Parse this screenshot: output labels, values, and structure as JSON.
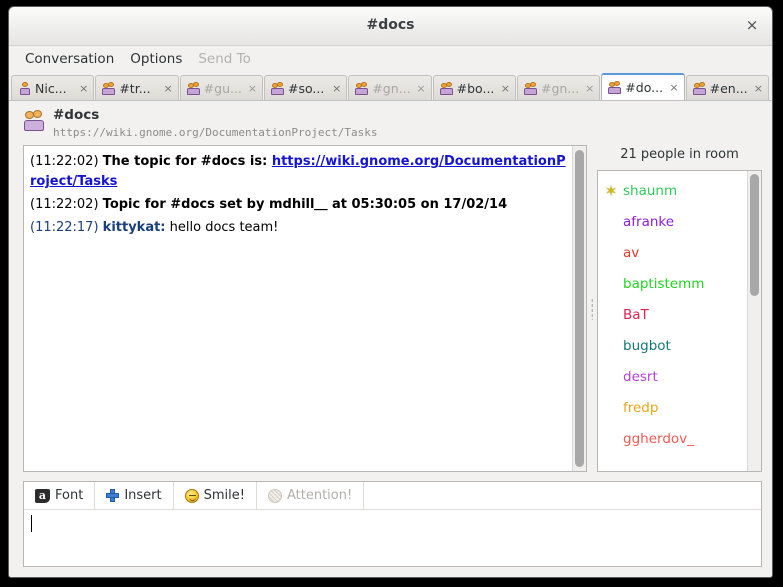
{
  "window": {
    "title": "#docs",
    "close_label": "×"
  },
  "menubar": {
    "items": [
      {
        "label": "Conversation",
        "disabled": false
      },
      {
        "label": "Options",
        "disabled": false
      },
      {
        "label": "Send To",
        "disabled": true
      }
    ]
  },
  "tabs": [
    {
      "label": "Nic...",
      "icon": "person-icon",
      "active": false,
      "unread": false,
      "close": "×"
    },
    {
      "label": "#tr...",
      "icon": "group-icon",
      "active": false,
      "unread": false,
      "close": "×"
    },
    {
      "label": "#gu...",
      "icon": "group-icon",
      "active": false,
      "unread": true,
      "close": "×"
    },
    {
      "label": "#so...",
      "icon": "group-icon",
      "active": false,
      "unread": false,
      "close": "×"
    },
    {
      "label": "#gn...",
      "icon": "group-icon",
      "active": false,
      "unread": true,
      "close": "×"
    },
    {
      "label": "#bo...",
      "icon": "group-icon",
      "active": false,
      "unread": false,
      "close": "×"
    },
    {
      "label": "#gn...",
      "icon": "group-icon",
      "active": false,
      "unread": true,
      "close": "×"
    },
    {
      "label": "#do...",
      "icon": "group-icon",
      "active": true,
      "unread": false,
      "close": "×"
    },
    {
      "label": "#en...",
      "icon": "group-icon",
      "active": false,
      "unread": false,
      "close": "×"
    }
  ],
  "conversation": {
    "name": "#docs",
    "topic_url": "https://wiki.gnome.org/DocumentationProject/Tasks"
  },
  "messages": [
    {
      "timestamp": "(11:22:02)",
      "timestamp_style": "system",
      "prefix": "The topic for #docs is: ",
      "link": "https://wiki.gnome.org/DocumentationProject/Tasks",
      "body": ""
    },
    {
      "timestamp": "(11:22:02)",
      "timestamp_style": "system",
      "prefix": "Topic for #docs set by mdhill⸏ at 05:30:05 on 17/02/14",
      "link": "",
      "body": ""
    },
    {
      "timestamp": "(11:22:17)",
      "timestamp_style": "user",
      "nick": "kittykat:",
      "prefix": "",
      "link": "",
      "body": " hello docs team!"
    }
  ],
  "userlist": {
    "count_label": "21 people in room",
    "users": [
      {
        "name": "shaunm",
        "color": "#2ecc5a",
        "badge": "operator-star-icon"
      },
      {
        "name": "afranke",
        "color": "#8b1fd8",
        "badge": ""
      },
      {
        "name": "av",
        "color": "#e8392a",
        "badge": ""
      },
      {
        "name": "baptistemm",
        "color": "#22d422",
        "badge": ""
      },
      {
        "name": "BaT",
        "color": "#e0204f",
        "badge": ""
      },
      {
        "name": "bugbot",
        "color": "#157a73",
        "badge": ""
      },
      {
        "name": "desrt",
        "color": "#b83fd8",
        "badge": ""
      },
      {
        "name": "fredp",
        "color": "#e8a517",
        "badge": ""
      },
      {
        "name": "ggherdov_",
        "color": "#ef5a52",
        "badge": ""
      }
    ]
  },
  "format_toolbar": {
    "buttons": [
      {
        "label": "Font",
        "icon": "font-icon",
        "disabled": false
      },
      {
        "label": "Insert",
        "icon": "plus-icon",
        "disabled": false
      },
      {
        "label": "Smile!",
        "icon": "smiley-icon",
        "disabled": false
      },
      {
        "label": "Attention!",
        "icon": "attention-icon",
        "disabled": true
      }
    ]
  },
  "entry": {
    "value": "",
    "placeholder": ""
  }
}
